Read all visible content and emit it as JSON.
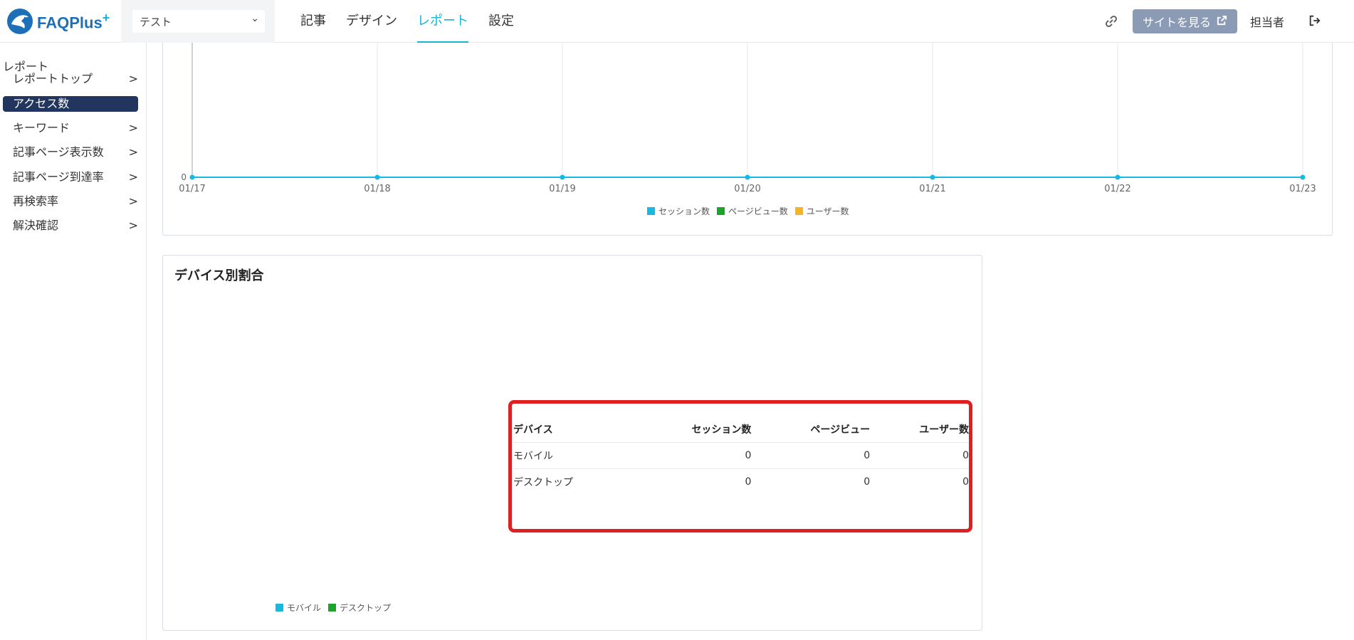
{
  "header": {
    "logo_text": "FAQPlus",
    "logo_plus": "+",
    "site_select": "テスト",
    "nav": [
      {
        "label": "記事",
        "active": false
      },
      {
        "label": "デザイン",
        "active": false
      },
      {
        "label": "レポート",
        "active": true
      },
      {
        "label": "設定",
        "active": false
      }
    ],
    "view_site_label": "サイトを見る",
    "user_label": "担当者"
  },
  "sidebar": {
    "heading": "レポート",
    "items": [
      {
        "label": "レポートトップ",
        "arrow": ">",
        "active": false
      },
      {
        "label": "アクセス数",
        "arrow": "",
        "active": true
      },
      {
        "label": "キーワード",
        "arrow": ">",
        "active": false
      },
      {
        "label": "記事ページ表示数",
        "arrow": ">",
        "active": false
      },
      {
        "label": "記事ページ到達率",
        "arrow": ">",
        "active": false
      },
      {
        "label": "再検索率",
        "arrow": ">",
        "active": false
      },
      {
        "label": "解決確認",
        "arrow": ">",
        "active": false
      }
    ]
  },
  "chart_data": {
    "type": "line",
    "x": [
      "01/17",
      "01/18",
      "01/19",
      "01/20",
      "01/21",
      "01/22",
      "01/23"
    ],
    "y_tick_labels": [
      "0"
    ],
    "series": [
      {
        "name": "セッション数",
        "values": [
          0,
          0,
          0,
          0,
          0,
          0,
          0
        ],
        "color": "#19b8e0"
      },
      {
        "name": "ページビュー数",
        "values": [
          0,
          0,
          0,
          0,
          0,
          0,
          0
        ],
        "color": "#1aa52a"
      },
      {
        "name": "ユーザー数",
        "values": [
          0,
          0,
          0,
          0,
          0,
          0,
          0
        ],
        "color": "#f5b520"
      }
    ],
    "grid": true,
    "legend_placement": "bottom-center"
  },
  "device": {
    "title": "デバイス別割合",
    "legend": [
      {
        "name": "モバイル",
        "color": "#19b8e0"
      },
      {
        "name": "デスクトップ",
        "color": "#1aa52a"
      }
    ],
    "table": {
      "headers": [
        "デバイス",
        "セッション数",
        "ページビュー",
        "ユーザー数"
      ],
      "rows": [
        [
          "モバイル",
          "0",
          "0",
          "0"
        ],
        [
          "デスクトップ",
          "0",
          "0",
          "0"
        ]
      ]
    },
    "highlight_color": "#e02020"
  }
}
